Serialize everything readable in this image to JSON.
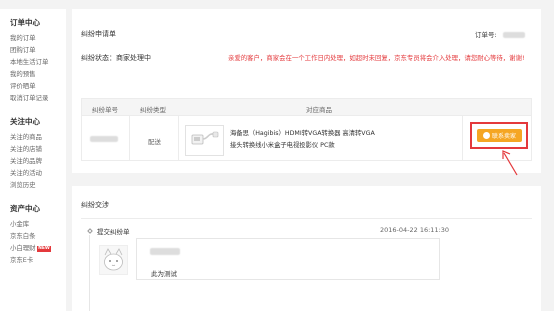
{
  "sidebar": {
    "groups": [
      {
        "title": "订单中心",
        "items": [
          "我的订单",
          "团购订单",
          "本地生活订单",
          "我的预售",
          "评价晒单",
          "取消订单记录"
        ]
      },
      {
        "title": "关注中心",
        "items": [
          "关注的商品",
          "关注的店铺",
          "关注的品牌",
          "关注的活动",
          "浏览历史"
        ]
      },
      {
        "title": "资产中心",
        "items": [
          "小金库",
          "京东白条",
          "小白理财",
          "京东E卡"
        ]
      }
    ],
    "new_badge": "NEW"
  },
  "dispute": {
    "title": "纠纷申请单",
    "order_no_label": "订单号:",
    "status": "纠纷状态：商家处理中",
    "notice": "亲爱的客户，商家会在一个工作日内处理，如超时未回复，京东专员将会介入处理，请您耐心等待，谢谢!",
    "columns": [
      "纠纷单号",
      "纠纷类型",
      "对应商品"
    ],
    "row": {
      "type": "配送",
      "product_name": "海备思（Hagibis）HDMI转VGA转换器 高清转VGA接头转换线小米盒子电视投影仪 PC款"
    },
    "contact_button": "联系卖家"
  },
  "exchange": {
    "title": "纠纷交涉",
    "entry_label": "提交纠纷单",
    "time": "2016-04-22 16:11:30",
    "message": "此为测试"
  },
  "colors": {
    "accent_red": "#e4393c",
    "button_orange": "#f5a623"
  }
}
